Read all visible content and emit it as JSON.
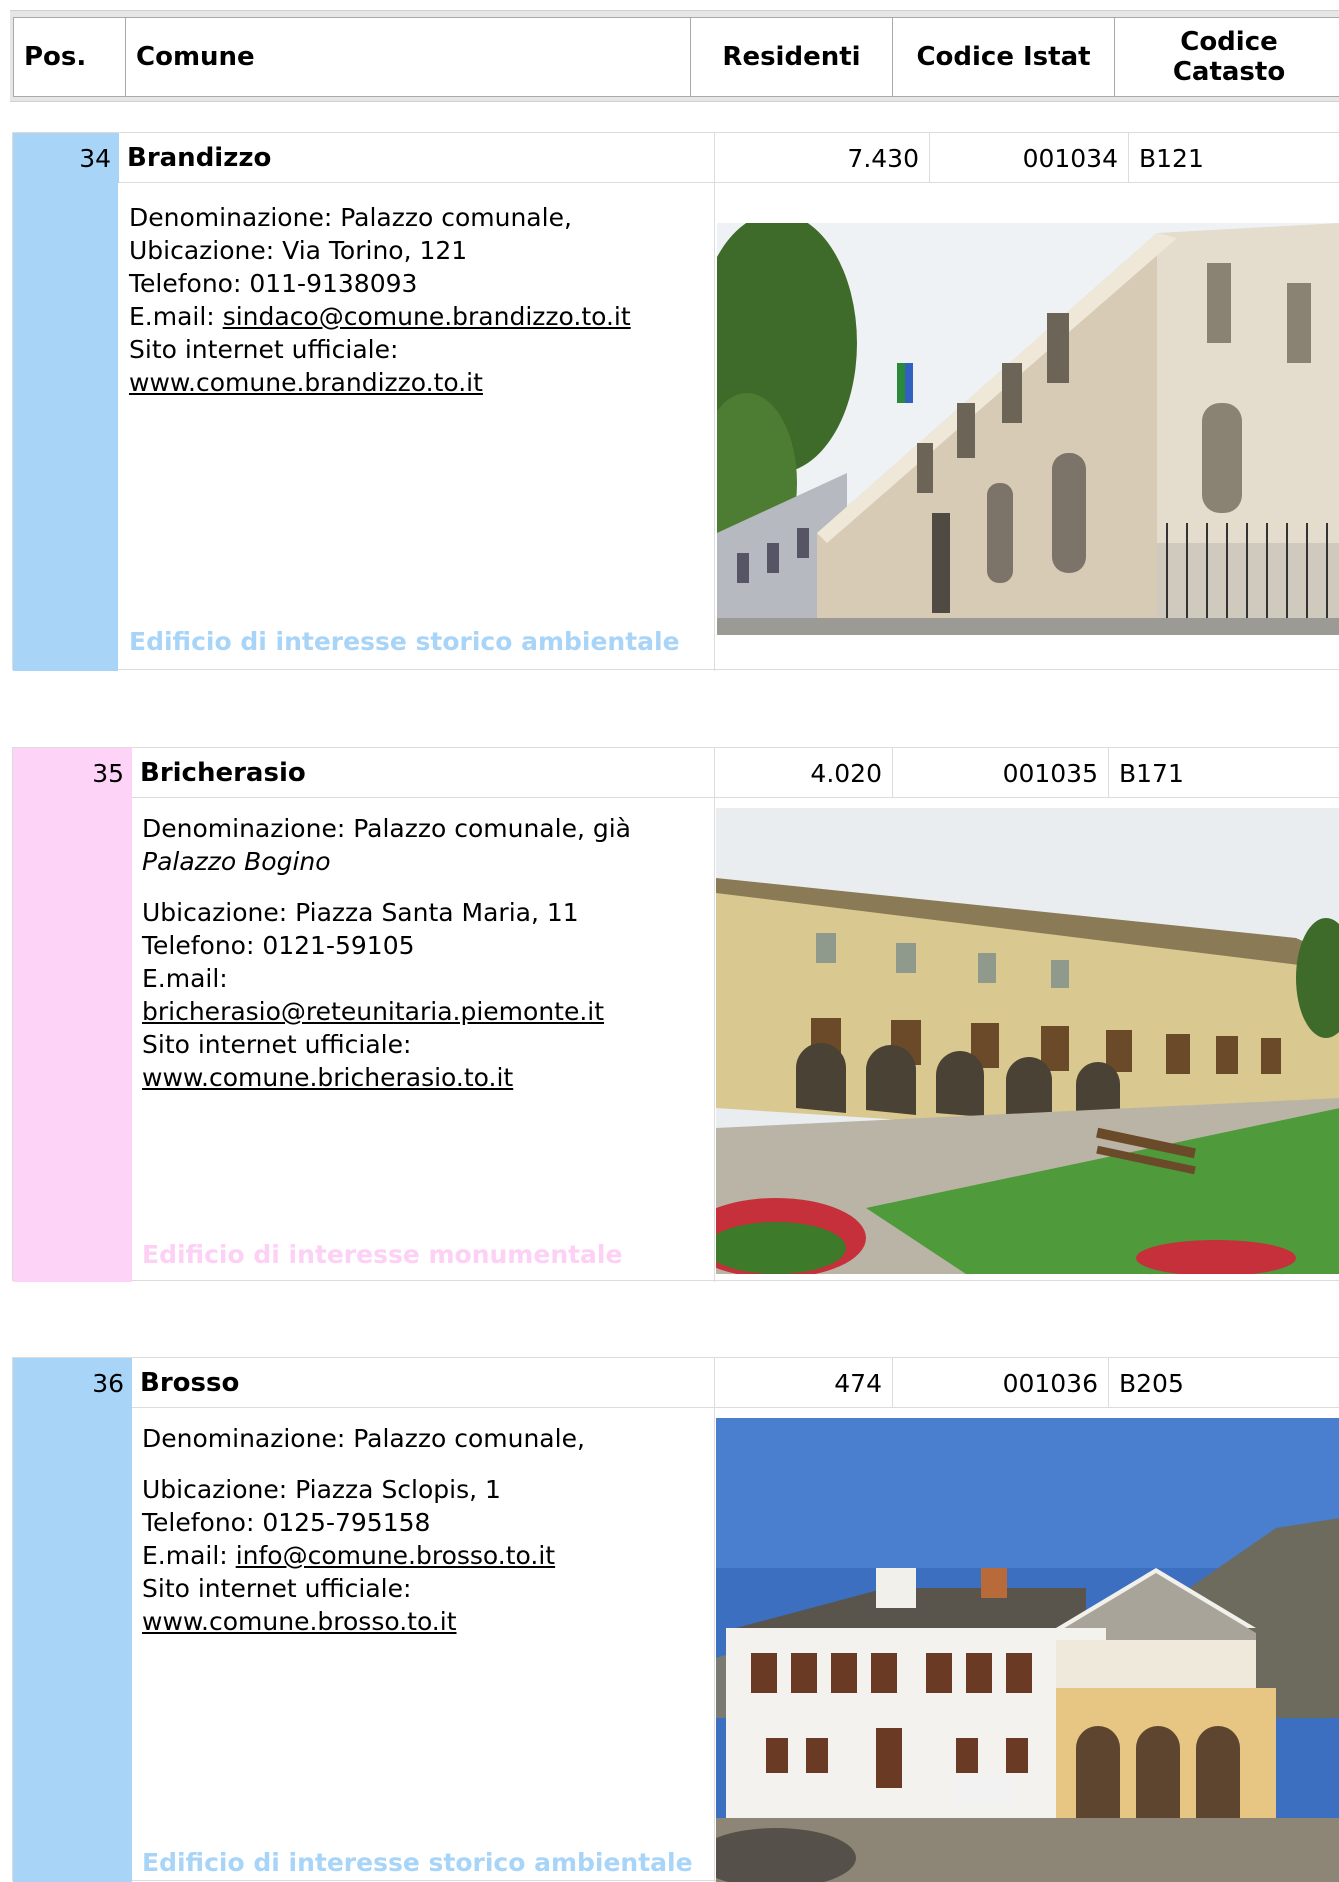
{
  "header": {
    "pos": "Pos.",
    "comune": "Comune",
    "residenti": "Residenti",
    "istat": "Codice Istat",
    "catasto_l1": "Codice",
    "catasto_l2": "Catasto"
  },
  "entries": [
    {
      "pos": "34",
      "name": "Brandizzo",
      "residenti": "7.430",
      "istat": "001034",
      "catasto": "B121",
      "denominazione": "Denominazione: Palazzo comunale,",
      "ubicazione": "Ubicazione: Via Torino, 121",
      "telefono": "Telefono: 011-9138093",
      "email_label": "E.mail: ",
      "email": "sindaco@comune.brandizzo.to.it",
      "sito_label": "Sito internet ufficiale:",
      "sito": "www.comune.brandizzo.to.it",
      "tag": "Edificio di interesse storico ambientale",
      "color": "#a8d4f8",
      "tag_color": "#a8d4f8"
    },
    {
      "pos": "35",
      "name": "Bricherasio",
      "residenti": "4.020",
      "istat": "001035",
      "catasto": "B171",
      "denominazione": "Denominazione: Palazzo comunale, già",
      "denominazione_it": "Palazzo Bogino",
      "ubicazione": "Ubicazione: Piazza Santa Maria, 11",
      "telefono": "Telefono: 0121-59105",
      "email_label": "E.mail:",
      "email": "bricherasio@reteunitaria.piemonte.it",
      "sito_label": "Sito internet ufficiale:",
      "sito": "www.comune.bricherasio.to.it",
      "tag": "Edificio di interesse monumentale",
      "color": "#fdd4f7",
      "tag_color": "#fdd0f5"
    },
    {
      "pos": "36",
      "name": "Brosso",
      "residenti": "474",
      "istat": "001036",
      "catasto": "B205",
      "denominazione": "Denominazione: Palazzo comunale,",
      "ubicazione": "Ubicazione: Piazza Sclopis, 1",
      "telefono": "Telefono: 0125-795158",
      "email_label": "E.mail: ",
      "email": "info@comune.brosso.to.it",
      "sito_label": "Sito internet ufficiale:",
      "sito": "www.comune.brosso.to.it",
      "tag": "Edificio di interesse storico ambientale",
      "color": "#a8d4f8",
      "tag_color": "#a8d4f8"
    }
  ]
}
